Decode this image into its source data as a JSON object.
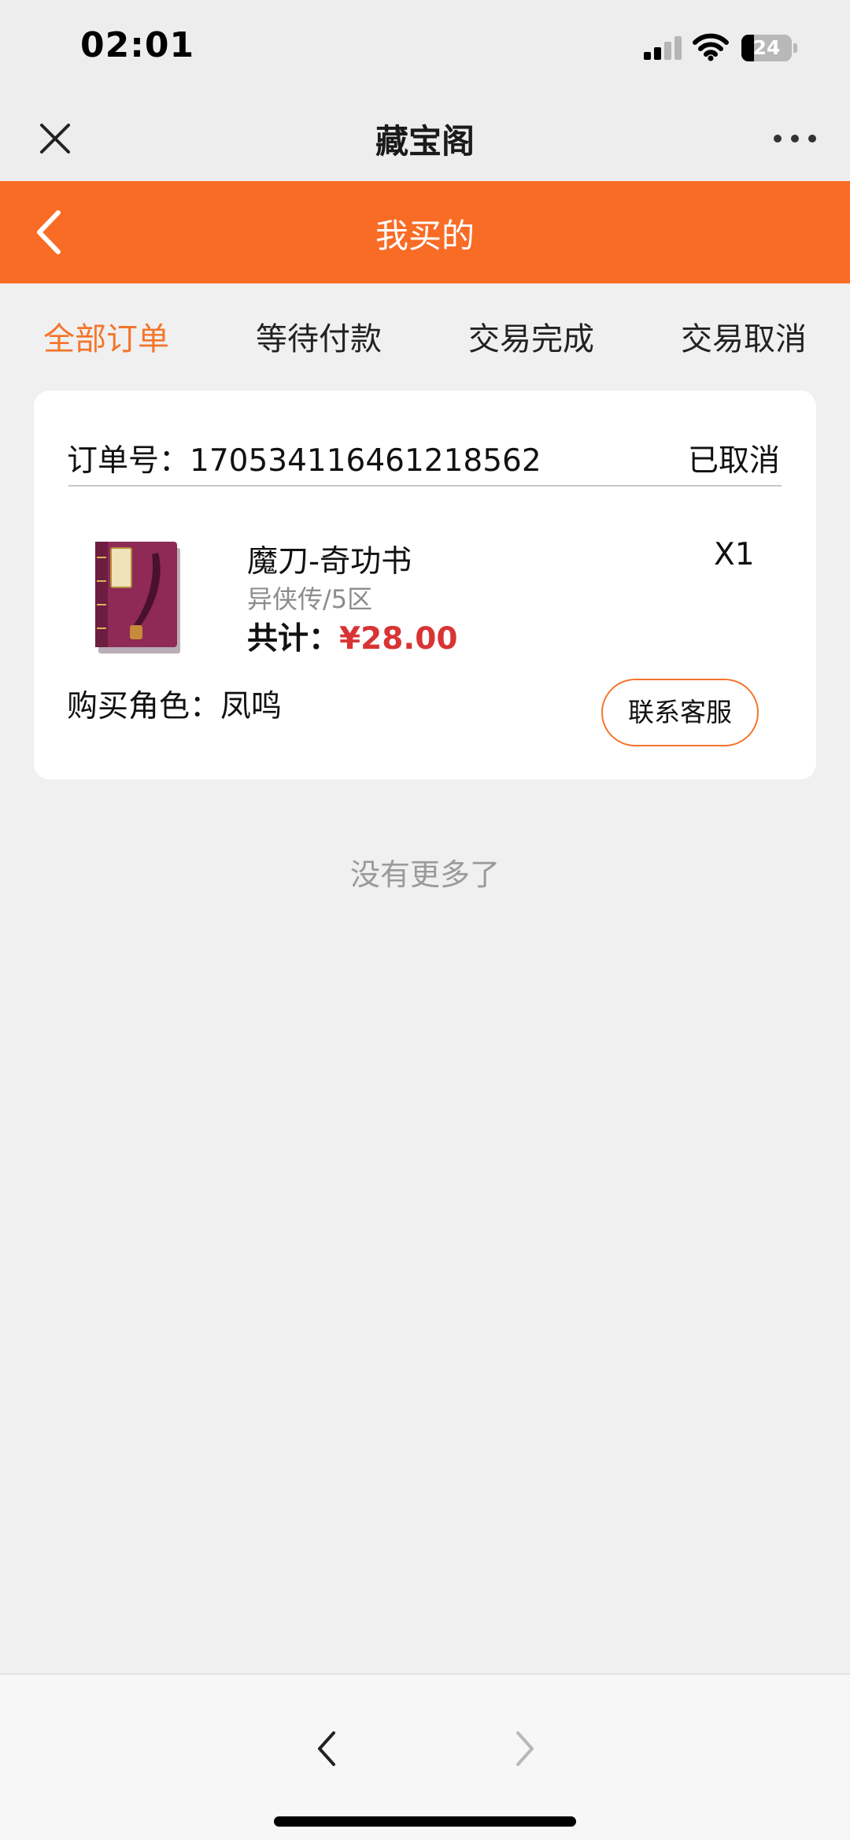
{
  "status_bar": {
    "time": "02:01",
    "battery_level": "24",
    "icons": [
      "cellular-signal-icon",
      "wifi-icon",
      "battery-icon"
    ]
  },
  "title_bar": {
    "title": "藏宝阁",
    "close_icon": "close-icon",
    "more_icon": "more-icon"
  },
  "header": {
    "title": "我买的",
    "back_icon": "chevron-left-icon",
    "color": "#f96c26"
  },
  "tabs": [
    {
      "label": "全部订单",
      "active": true
    },
    {
      "label": "等待付款",
      "active": false
    },
    {
      "label": "交易完成",
      "active": false
    },
    {
      "label": "交易取消",
      "active": false
    }
  ],
  "order": {
    "number_label": "订单号：1705341164612185​62",
    "status": "已取消",
    "product_name": "魔刀-奇功书",
    "server": "异侠传/5区",
    "total_label": "共计：",
    "total_price": "¥28.00",
    "quantity": "X1",
    "buyer_role": "购买角色：凤鸣",
    "contact_button": "联系客服"
  },
  "footer_text": "没有更多了",
  "colors": {
    "accent": "#f96c26",
    "active_tab": "#f5752b",
    "price": "#d83434",
    "background": "#f0f0f0"
  }
}
